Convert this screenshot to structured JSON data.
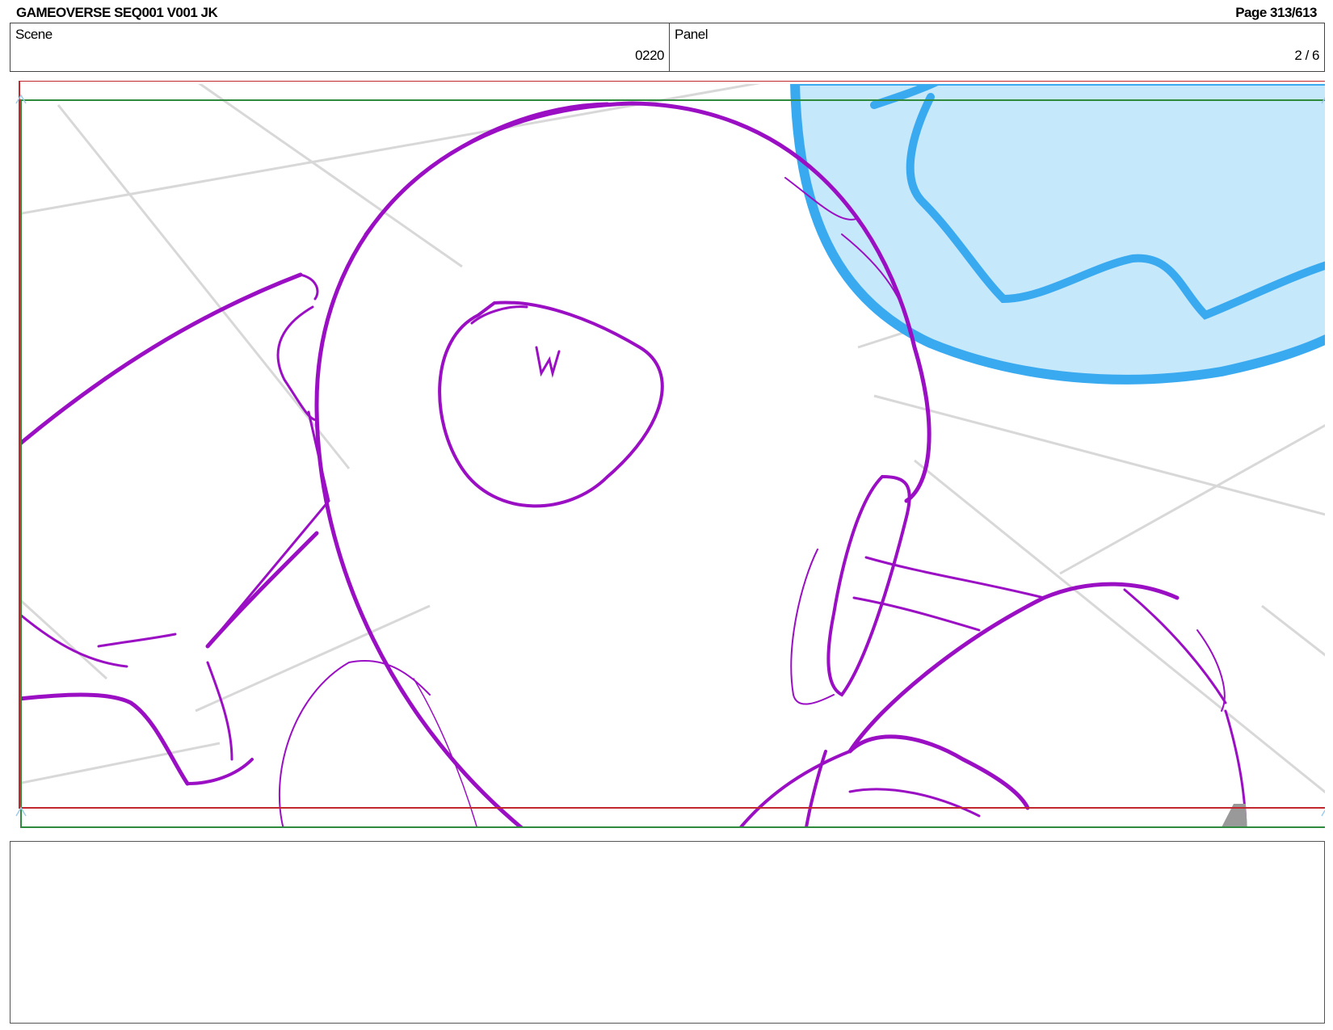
{
  "header": {
    "title": "GAMEOVERSE SEQ001 V001 JK",
    "page": "Page 313/613"
  },
  "info": {
    "scene_label": "Scene",
    "scene_value": "0220",
    "panel_label": "Panel",
    "panel_value": "2 / 6"
  },
  "colors": {
    "sketch": "#9b0fc4",
    "bubble_fill": "#c6e8fb",
    "bubble_stroke": "#3aaaf0",
    "grid": "#d8d8d8",
    "safe_frame_red": "#c0282d",
    "safe_frame_green": "#2e8b3e"
  },
  "notes": {
    "text": ""
  }
}
